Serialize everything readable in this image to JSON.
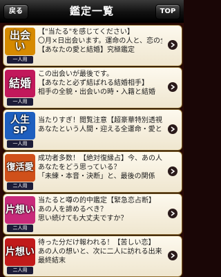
{
  "nav": {
    "back_label": "戻る",
    "title": "鑑定一覧",
    "top_label": "TOP"
  },
  "colors": {
    "badge_1": "#d68a00",
    "badge_2": "#c2185b",
    "badge_3": "#1e5fbf",
    "badge_4": "#d0501a",
    "badge_5": "#c82a7a",
    "badge_6": "#c11a1a"
  },
  "items": [
    {
      "badge_lines": [
        "出会い"
      ],
      "people": "一人用",
      "lines": [
        "【\"当たる\"を感じてください】",
        "〇月×日出会います。運命の人と、恋の全貌",
        "【あなたの愛と結婚】究極鑑定"
      ],
      "icon": "chevron-right-icon"
    },
    {
      "badge_lines": [
        "結婚"
      ],
      "people": "一人用",
      "lines": [
        "この出会いが最後です。",
        "【あなたと必ず結ばれる結婚相手】",
        "相手の全貌・出会いの時・入籍と結婚"
      ],
      "icon": "chevron-right-icon"
    },
    {
      "badge_lines": [
        "人生",
        "SP"
      ],
      "people": "一人用",
      "lines": [
        "当たりすぎ！閲覧注意【超豪華特別透視パック】",
        "あなたという人間・迎える全運命・愛と結婚"
      ],
      "icon": "chevron-right-icon"
    },
    {
      "badge_lines": [
        "復活愛"
      ],
      "people": "二人用",
      "lines": [
        "成功者多数！【絶対復縁占】今、あの人は",
        "あなたをどう思っている？",
        "「未練・本音・決断」と、最後の関係"
      ],
      "icon": "chevron-right-icon"
    },
    {
      "badge_lines": [
        "片想い"
      ],
      "people": "二人用",
      "lines": [
        "当たると噂の的中鑑定【緊急恋占断】",
        "あの人を諦めるべき？",
        "思い続けても大丈夫ですか？"
      ],
      "icon": "chevron-right-icon"
    },
    {
      "badge_lines": [
        "片想い"
      ],
      "people": "二人用",
      "lines": [
        "待った分だけ報われる！【苦しい恋】",
        "あの人の想いと、次に二人に訪れる出来事、",
        "最終結末"
      ],
      "icon": "chevron-right-icon"
    }
  ]
}
